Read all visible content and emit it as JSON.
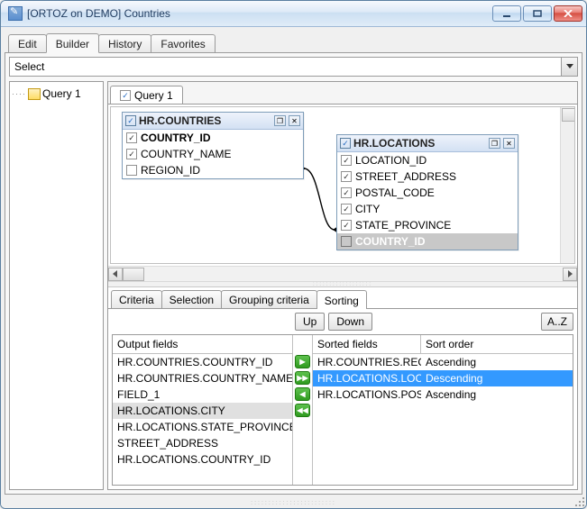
{
  "window": {
    "title": "[ORTOZ on DEMO] Countries"
  },
  "top_tabs": [
    "Edit",
    "Builder",
    "History",
    "Favorites"
  ],
  "top_tab_active": 1,
  "select_value": "Select",
  "tree": {
    "items": [
      {
        "label": "Query 1"
      }
    ]
  },
  "inner_tabs": [
    {
      "label": "Query 1",
      "checked": true
    }
  ],
  "tables": {
    "countries": {
      "title": "HR.COUNTRIES",
      "checked": true,
      "cols": [
        {
          "label": "COUNTRY_ID",
          "checked": true,
          "bold": true
        },
        {
          "label": "COUNTRY_NAME",
          "checked": true,
          "bold": false
        },
        {
          "label": "REGION_ID",
          "checked": false,
          "bold": false
        }
      ]
    },
    "locations": {
      "title": "HR.LOCATIONS",
      "checked": true,
      "cols": [
        {
          "label": "LOCATION_ID",
          "checked": true
        },
        {
          "label": "STREET_ADDRESS",
          "checked": true
        },
        {
          "label": "POSTAL_CODE",
          "checked": true
        },
        {
          "label": "CITY",
          "checked": true
        },
        {
          "label": "STATE_PROVINCE",
          "checked": true
        },
        {
          "label": "COUNTRY_ID",
          "checked": false,
          "hilite": true
        }
      ]
    }
  },
  "bottom_tabs": [
    "Criteria",
    "Selection",
    "Grouping criteria",
    "Sorting"
  ],
  "bottom_tab_active": 3,
  "sort_buttons": {
    "up": "Up",
    "down": "Down",
    "az": "A..Z"
  },
  "output_fields": {
    "header": "Output fields",
    "items": [
      "HR.COUNTRIES.COUNTRY_ID",
      "HR.COUNTRIES.COUNTRY_NAME",
      "FIELD_1",
      "HR.LOCATIONS.CITY",
      "HR.LOCATIONS.STATE_PROVINCE",
      "STREET_ADDRESS",
      "HR.LOCATIONS.COUNTRY_ID"
    ],
    "selected": 3
  },
  "sorted_fields": {
    "headers": [
      "Sorted fields",
      "Sort order"
    ],
    "rows": [
      {
        "field": "HR.COUNTRIES.REGION_ID",
        "display_field": "HR.COUNTRIES.REG",
        "order": "Ascending"
      },
      {
        "field": "HR.LOCATIONS.LOCATION_ID",
        "display_field": "HR.LOCATIONS.LOC",
        "order": "Descending"
      },
      {
        "field": "HR.LOCATIONS.POSTAL_CODE",
        "display_field": "HR.LOCATIONS.POS",
        "order": "Ascending"
      }
    ],
    "selected": 1
  }
}
